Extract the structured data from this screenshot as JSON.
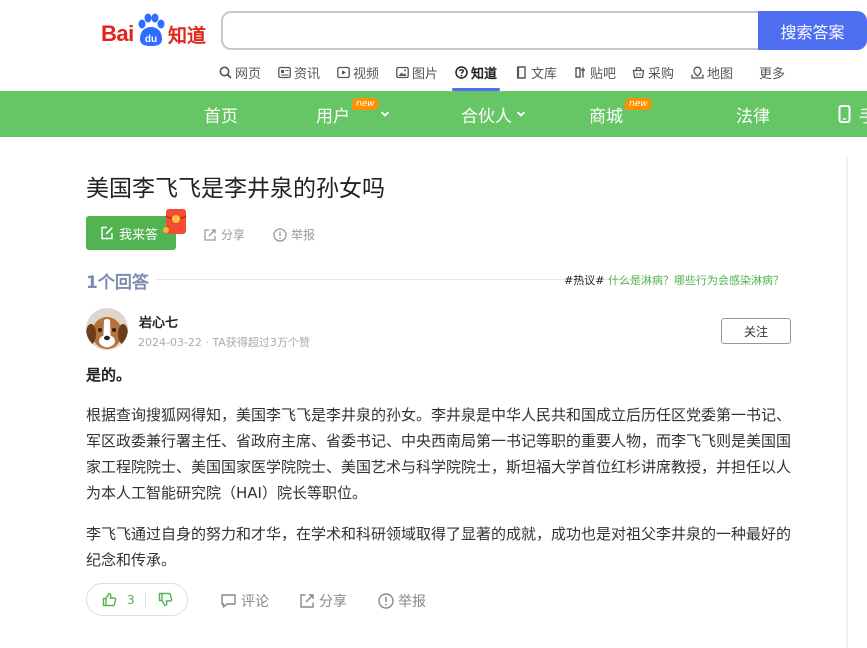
{
  "logo": {
    "bai": "Bai",
    "du": "du",
    "zhidao": "知道"
  },
  "search": {
    "value": "",
    "placeholder": "",
    "button_label": "搜索答案"
  },
  "nav": [
    {
      "label": "网页",
      "icon": "search-icon"
    },
    {
      "label": "资讯",
      "icon": "news-icon"
    },
    {
      "label": "视频",
      "icon": "video-icon"
    },
    {
      "label": "图片",
      "icon": "image-icon"
    },
    {
      "label": "知道",
      "icon": "question-icon",
      "active": true
    },
    {
      "label": "文库",
      "icon": "doc-icon"
    },
    {
      "label": "贴吧",
      "icon": "tieba-icon"
    },
    {
      "label": "采购",
      "icon": "cart-icon"
    },
    {
      "label": "地图",
      "icon": "map-icon"
    },
    {
      "label": "更多"
    }
  ],
  "greenbar": {
    "items": [
      {
        "label": "首页"
      },
      {
        "label": "用户",
        "badge": "new"
      },
      {
        "label": "合伙人"
      },
      {
        "label": "商城",
        "badge": "new"
      },
      {
        "label": "法律"
      },
      {
        "label": "手"
      }
    ]
  },
  "question": {
    "title": "美国李飞飞是李井泉的孙女吗",
    "answer_button": "我来答",
    "share": "分享",
    "report": "举报"
  },
  "answers_header": {
    "count_label": "1个回答",
    "hot_tag": "#热议#",
    "hot_link": "什么是淋病？哪些行为会感染淋病？"
  },
  "answer": {
    "user": "岩心七",
    "date": "2024-03-22",
    "dot": "·",
    "meta": "TA获得超过3万个赞",
    "follow": "关注",
    "paragraphs": [
      "是的。",
      "根据查询搜狐网得知，美国李飞飞是李井泉的孙女。李井泉是中华人民共和国成立后历任区党委第一书记、军区政委兼行署主任、省政府主席、省委书记、中央西南局第一书记等职的重要人物，而李飞飞则是美国国家工程院院士、美国国家医学院院士、美国艺术与科学院院士，斯坦福大学首位红杉讲席教授，并担任以人为本人工智能研究院（HAI）院长等职位。",
      "李飞飞通过自身的努力和才华，在学术和科研领域取得了显著的成就，成功也是对祖父李井泉的一种最好的纪念和传承。"
    ],
    "likes": "3",
    "comment": "评论",
    "share": "分享",
    "report": "举报"
  },
  "colors": {
    "brand_red": "#e1251b",
    "brand_blue": "#4e6ef2",
    "green": "#66c564",
    "accent_green": "#52b450"
  }
}
